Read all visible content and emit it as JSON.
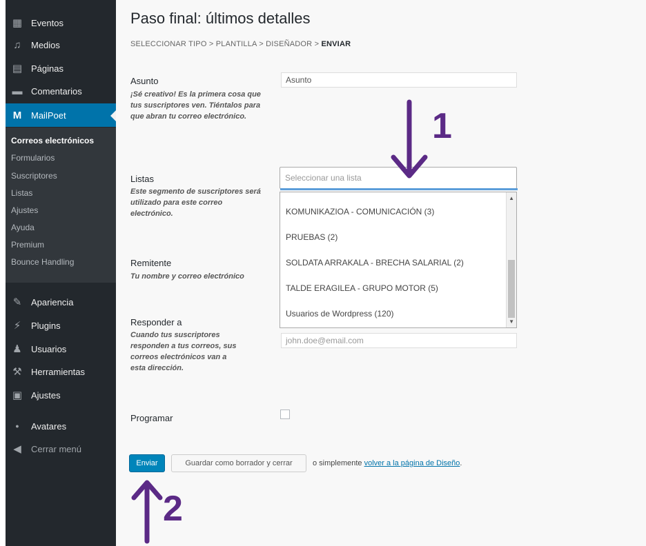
{
  "sidebar": {
    "menu": [
      {
        "label": "Eventos",
        "icon": "calendar-icon"
      },
      {
        "label": "Medios",
        "icon": "media-icon"
      },
      {
        "label": "Páginas",
        "icon": "pages-icon"
      },
      {
        "label": "Comentarios",
        "icon": "comments-icon"
      },
      {
        "label": "MailPoet",
        "icon": "mailpoet-icon"
      }
    ],
    "submenu": [
      "Correos electrónicos",
      "Formularios",
      "Suscriptores",
      "Listas",
      "Ajustes",
      "Ayuda",
      "Premium",
      "Bounce Handling"
    ],
    "menu2": [
      {
        "label": "Apariencia",
        "icon": "brush-icon"
      },
      {
        "label": "Plugins",
        "icon": "plugin-icon"
      },
      {
        "label": "Usuarios",
        "icon": "users-icon"
      },
      {
        "label": "Herramientas",
        "icon": "tools-icon"
      },
      {
        "label": "Ajustes",
        "icon": "settings-icon"
      },
      {
        "label": "Avatares",
        "icon": "avatar-icon"
      },
      {
        "label": "Cerrar menú",
        "icon": "collapse-icon"
      }
    ]
  },
  "page": {
    "title": "Paso final: últimos detalles",
    "breadcrumb": {
      "steps": "SELECCIONAR TIPO > PLANTILLA > DISEÑADOR > ",
      "current": "ENVIAR"
    }
  },
  "fields": {
    "subject": {
      "label": "Asunto",
      "help": "¡Sé creativo! Es la primera cosa que tus suscriptores ven. Tiéntalos para que abran tu correo electrónico.",
      "value": "Asunto"
    },
    "lists": {
      "label": "Listas",
      "help": "Este segmento de suscriptores será utilizado para este correo electrónico.",
      "placeholder": "Seleccionar una lista",
      "options": [
        "KOMUNIKAZIOA - COMUNICACIÓN (3)",
        "PRUEBAS (2)",
        "SOLDATA ARRAKALA - BRECHA SALARIAL (2)",
        "TALDE ERAGILEA - GRUPO MOTOR (5)",
        "Usuarios de Wordpress (120)"
      ]
    },
    "sender": {
      "label": "Remitente",
      "help": "Tu nombre y correo electrónico"
    },
    "reply_to": {
      "label": "Responder a",
      "help": "Cuando tus suscriptores responden a tus correos, sus correos electrónicos van a esta dirección.",
      "placeholder": "john.doe@email.com"
    },
    "schedule": {
      "label": "Programar"
    }
  },
  "actions": {
    "send": "Enviar",
    "save_draft": "Guardar como borrador y cerrar",
    "or_text": "o simplemente ",
    "back_link": "volver a la página de Diseño",
    "period": "."
  },
  "annotations": {
    "arrow1": "1",
    "arrow2": "2",
    "color": "#5b2a86"
  },
  "colors": {
    "sidebar": "#23282d",
    "accent": "#0073aa",
    "button": "#0085ba"
  }
}
